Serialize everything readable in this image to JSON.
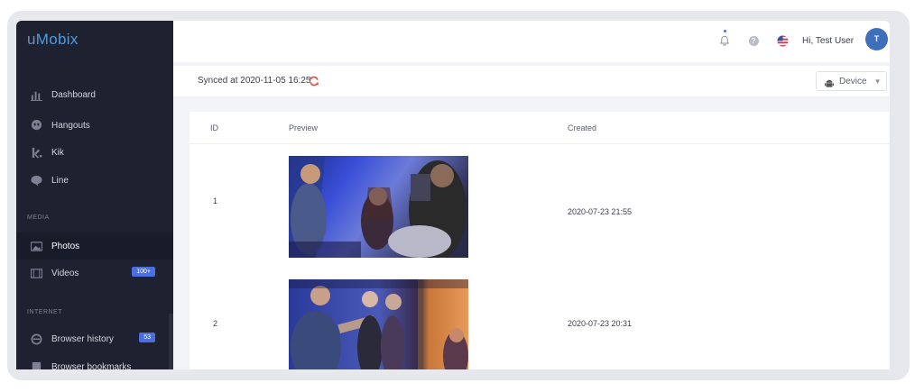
{
  "app": {
    "logo_prefix": "u",
    "logo_name": "Mobix"
  },
  "sidebar": {
    "items": [
      {
        "label": "Dashboard",
        "icon": "bar-chart-icon"
      },
      {
        "label": "Hangouts",
        "icon": "hangouts-icon"
      },
      {
        "label": "Kik",
        "icon": "kik-icon"
      },
      {
        "label": "Line",
        "icon": "line-icon"
      }
    ],
    "sections": [
      {
        "title": "MEDIA",
        "items": [
          {
            "label": "Photos",
            "icon": "photo-icon",
            "active": true
          },
          {
            "label": "Videos",
            "icon": "film-icon",
            "badge": "100+"
          }
        ]
      },
      {
        "title": "INTERNET",
        "items": [
          {
            "label": "Browser history",
            "icon": "browser-icon",
            "badge": "53"
          },
          {
            "label": "Browser bookmarks",
            "icon": "bookmark-icon"
          }
        ]
      }
    ]
  },
  "header": {
    "greeting": "Hi, Test User",
    "avatar_initial": "T"
  },
  "syncbar": {
    "synced_text": "Synced at 2020-11-05 16:25",
    "device_label": "Device"
  },
  "table": {
    "columns": [
      "ID",
      "Preview",
      "Created"
    ],
    "rows": [
      {
        "id": "1",
        "created": "2020-07-23 21:55"
      },
      {
        "id": "2",
        "created": "2020-07-23 20:31"
      }
    ]
  },
  "colors": {
    "sidebar_bg": "#1e2230",
    "accent": "#4b6fe0",
    "avatar": "#3e6fba",
    "sync_icon": "#e0473a"
  }
}
